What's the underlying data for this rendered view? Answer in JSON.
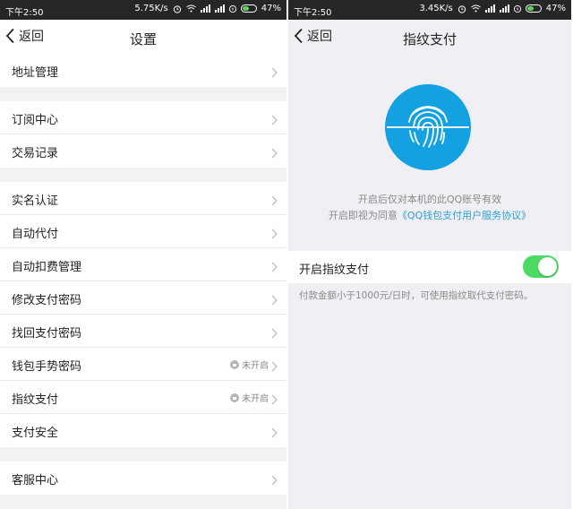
{
  "left": {
    "status": {
      "time": "下午2:50",
      "speed": "5.75K/s",
      "battery": "47%"
    },
    "nav": {
      "back": "返回",
      "title": "设置"
    },
    "groups": [
      [
        {
          "label": "地址管理"
        }
      ],
      [
        {
          "label": "订阅中心"
        },
        {
          "label": "交易记录"
        }
      ],
      [
        {
          "label": "实名认证"
        },
        {
          "label": "自动代付"
        },
        {
          "label": "自动扣费管理"
        },
        {
          "label": "修改支付密码"
        },
        {
          "label": "找回支付密码"
        },
        {
          "label": "钱包手势密码",
          "state": "未开启"
        },
        {
          "label": "指纹支付",
          "state": "未开启"
        },
        {
          "label": "支付安全"
        }
      ],
      [
        {
          "label": "客服中心"
        }
      ]
    ]
  },
  "right": {
    "status": {
      "time": "下午2:50",
      "speed": "3.45K/s",
      "battery": "47%"
    },
    "nav": {
      "back": "返回",
      "title": "指纹支付"
    },
    "hint_line1": "开启后仅对本机的此QQ账号有效",
    "hint_line2_prefix": "开启即视为同意",
    "hint_link": "《QQ钱包支付用户服务协议》",
    "toggle": {
      "label": "开启指纹支付",
      "on": true
    },
    "note": "付款金额小于1000元/日时，可使用指纹取代支付密码。"
  },
  "colors": {
    "fingerprint_bg": "#13a1e2",
    "toggle_on": "#4cd964",
    "link": "#2aa0d8",
    "status_bar": "#262626"
  }
}
